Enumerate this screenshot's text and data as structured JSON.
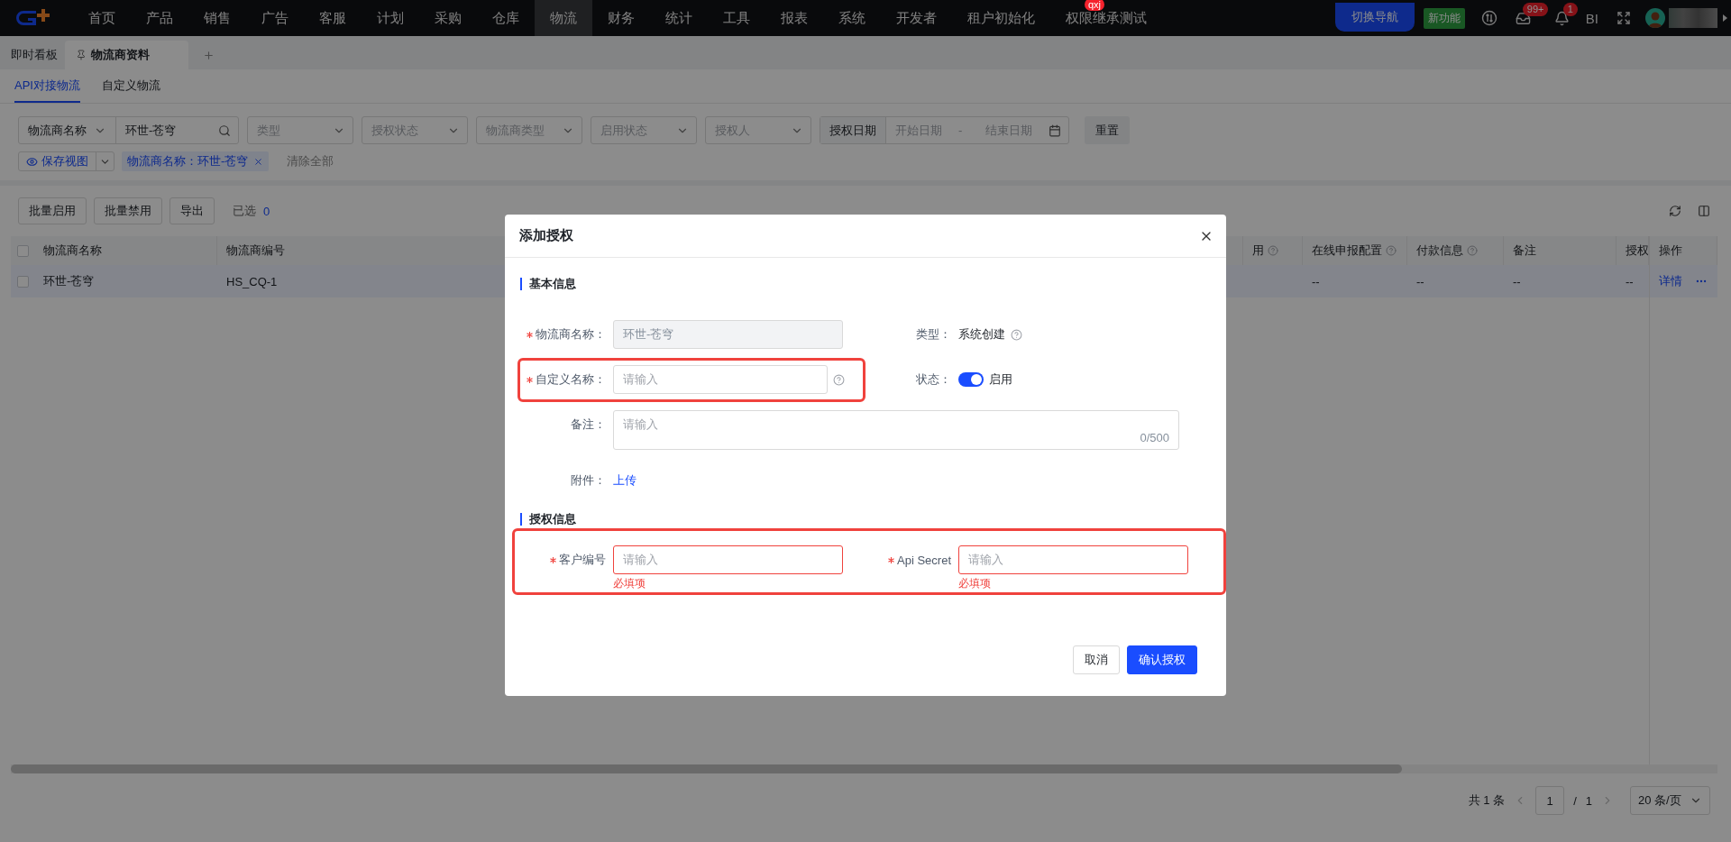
{
  "top_nav": {
    "menu": [
      {
        "label": "首页",
        "selected": false
      },
      {
        "label": "产品",
        "selected": false
      },
      {
        "label": "销售",
        "selected": false
      },
      {
        "label": "广告",
        "selected": false
      },
      {
        "label": "客服",
        "selected": false
      },
      {
        "label": "计划",
        "selected": false
      },
      {
        "label": "采购",
        "selected": false
      },
      {
        "label": "仓库",
        "selected": false
      },
      {
        "label": "物流",
        "selected": true
      },
      {
        "label": "财务",
        "selected": false
      },
      {
        "label": "统计",
        "selected": false
      },
      {
        "label": "工具",
        "selected": false
      },
      {
        "label": "报表",
        "selected": false
      },
      {
        "label": "系统",
        "selected": false
      },
      {
        "label": "开发者",
        "selected": false
      },
      {
        "label": "租户初始化",
        "selected": false
      },
      {
        "label": "权限继承测试",
        "selected": false,
        "badge": "qxj"
      }
    ],
    "switch_nav": "切换导航",
    "new_feature": "新功能",
    "inbox_badge": "99+",
    "bell_badge": "1",
    "bi": "BI"
  },
  "page_tabs": [
    {
      "label": "即时看板",
      "selected": false,
      "pinned": false
    },
    {
      "label": "物流商资料",
      "selected": true,
      "pinned": true
    }
  ],
  "sub_tabs": [
    {
      "label": "API对接物流",
      "selected": true
    },
    {
      "label": "自定义物流",
      "selected": false
    }
  ],
  "filters": {
    "search": {
      "field": "物流商名称",
      "value": "环世-苍穹"
    },
    "selects": [
      {
        "placeholder": "类型"
      },
      {
        "placeholder": "授权状态"
      },
      {
        "placeholder": "物流商类型"
      },
      {
        "placeholder": "启用状态"
      },
      {
        "placeholder": "授权人"
      }
    ],
    "date": {
      "label": "授权日期",
      "start_placeholder": "开始日期",
      "separator": "-",
      "end_placeholder": "结束日期"
    },
    "reset": "重置"
  },
  "view": {
    "save_view": "保存视图",
    "chips": [
      {
        "label": "物流商名称：环世-苍穹"
      }
    ],
    "clear_all": "清除全部"
  },
  "toolbar": {
    "buttons": [
      "批量启用",
      "批量禁用",
      "导出"
    ],
    "selected_label": "已选",
    "selected_count": "0"
  },
  "table": {
    "all_checked": false,
    "columns": [
      {
        "label": "物流商名称",
        "help": false
      },
      {
        "label": "物流商编号",
        "help": false
      },
      {
        "label": "用",
        "help": true
      },
      {
        "label": "在线申报配置",
        "help": true
      },
      {
        "label": "付款信息",
        "help": true
      },
      {
        "label": "备注",
        "help": false
      },
      {
        "label": "授权"
      }
    ],
    "action_column": "操作",
    "rows": [
      {
        "checked": false,
        "name": "环世-苍穹",
        "code": "HS_CQ-1",
        "values": [
          "--",
          "--",
          "--",
          "--"
        ],
        "actions": [
          "详情"
        ]
      }
    ]
  },
  "pagination": {
    "total": "共 1 条",
    "page": "1",
    "slash": "/",
    "pages": "1",
    "page_size": "20 条/页"
  },
  "modal": {
    "title": "添加授权",
    "footer": {
      "cancel": "取消",
      "confirm": "确认授权"
    },
    "sections": [
      {
        "title": "基本信息",
        "rows": [
          {
            "highlighted": false,
            "fields": [
              {
                "kind": "input",
                "label": "物流商名称：",
                "required": true,
                "disabled": true,
                "value": "环世-苍穹",
                "help": false,
                "highlighted": false
              },
              {
                "kind": "text",
                "label": "类型：",
                "required": false,
                "value": "系统创建",
                "help": true,
                "highlighted": false
              }
            ]
          },
          {
            "highlighted": false,
            "fields": [
              {
                "kind": "input",
                "label": "自定义名称：",
                "required": true,
                "disabled": false,
                "placeholder": "请输入",
                "help": true,
                "highlighted": true
              },
              {
                "kind": "switch",
                "label": "状态：",
                "required": false,
                "on": true,
                "text": "启用",
                "highlighted": false
              }
            ]
          },
          {
            "highlighted": false,
            "fields": [
              {
                "kind": "textarea",
                "label": "备注：",
                "required": false,
                "placeholder": "请输入",
                "counter": "0/500",
                "highlighted": false
              }
            ]
          },
          {
            "highlighted": false,
            "fields": [
              {
                "kind": "link",
                "label": "附件：",
                "required": false,
                "text": "上传",
                "highlighted": false
              }
            ]
          }
        ]
      },
      {
        "title": "授权信息",
        "rows": [
          {
            "highlighted": true,
            "fields": [
              {
                "kind": "input",
                "label": "客户编号",
                "required": true,
                "disabled": false,
                "placeholder": "请输入",
                "error": "必填项",
                "help": false,
                "highlighted": false
              },
              {
                "kind": "input",
                "label": "Api Secret",
                "required": true,
                "disabled": false,
                "placeholder": "请输入",
                "error": "必填项",
                "help": false,
                "highlighted": false
              }
            ]
          }
        ]
      }
    ]
  }
}
